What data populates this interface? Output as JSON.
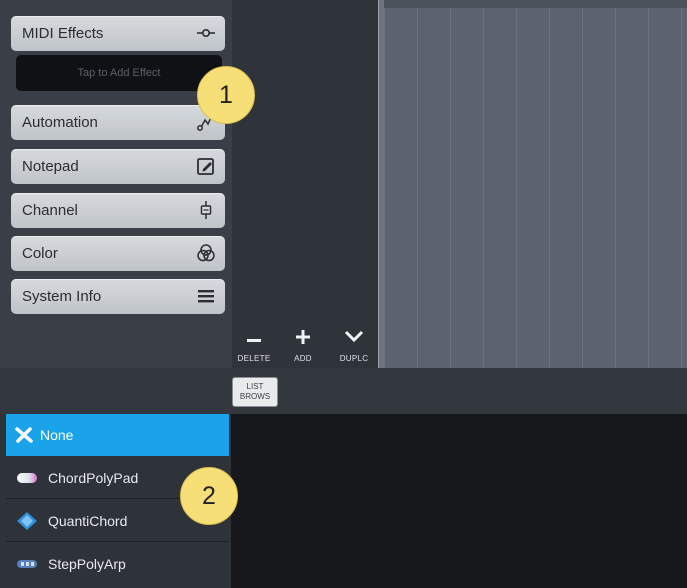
{
  "inspector": {
    "midi_effects_label": "MIDI Effects",
    "add_effect_placeholder": "Tap to Add Effect",
    "automation_label": "Automation",
    "notepad_label": "Notepad",
    "channel_label": "Channel",
    "color_label": "Color",
    "system_info_label": "System Info"
  },
  "toolbar": {
    "delete_label": "DELETE",
    "add_label": "ADD",
    "duplicate_label": "DUPLC"
  },
  "list_browse": {
    "line1": "LIST",
    "line2": "BROWS"
  },
  "browser": {
    "items": [
      {
        "label": "None",
        "selected": true
      },
      {
        "label": "ChordPolyPad",
        "selected": false
      },
      {
        "label": "QuantiChord",
        "selected": false
      },
      {
        "label": "StepPolyArp",
        "selected": false
      }
    ]
  },
  "callouts": {
    "one": "1",
    "two": "2"
  },
  "colors": {
    "selection": "#1aa3e8",
    "callout": "#f6df77"
  }
}
